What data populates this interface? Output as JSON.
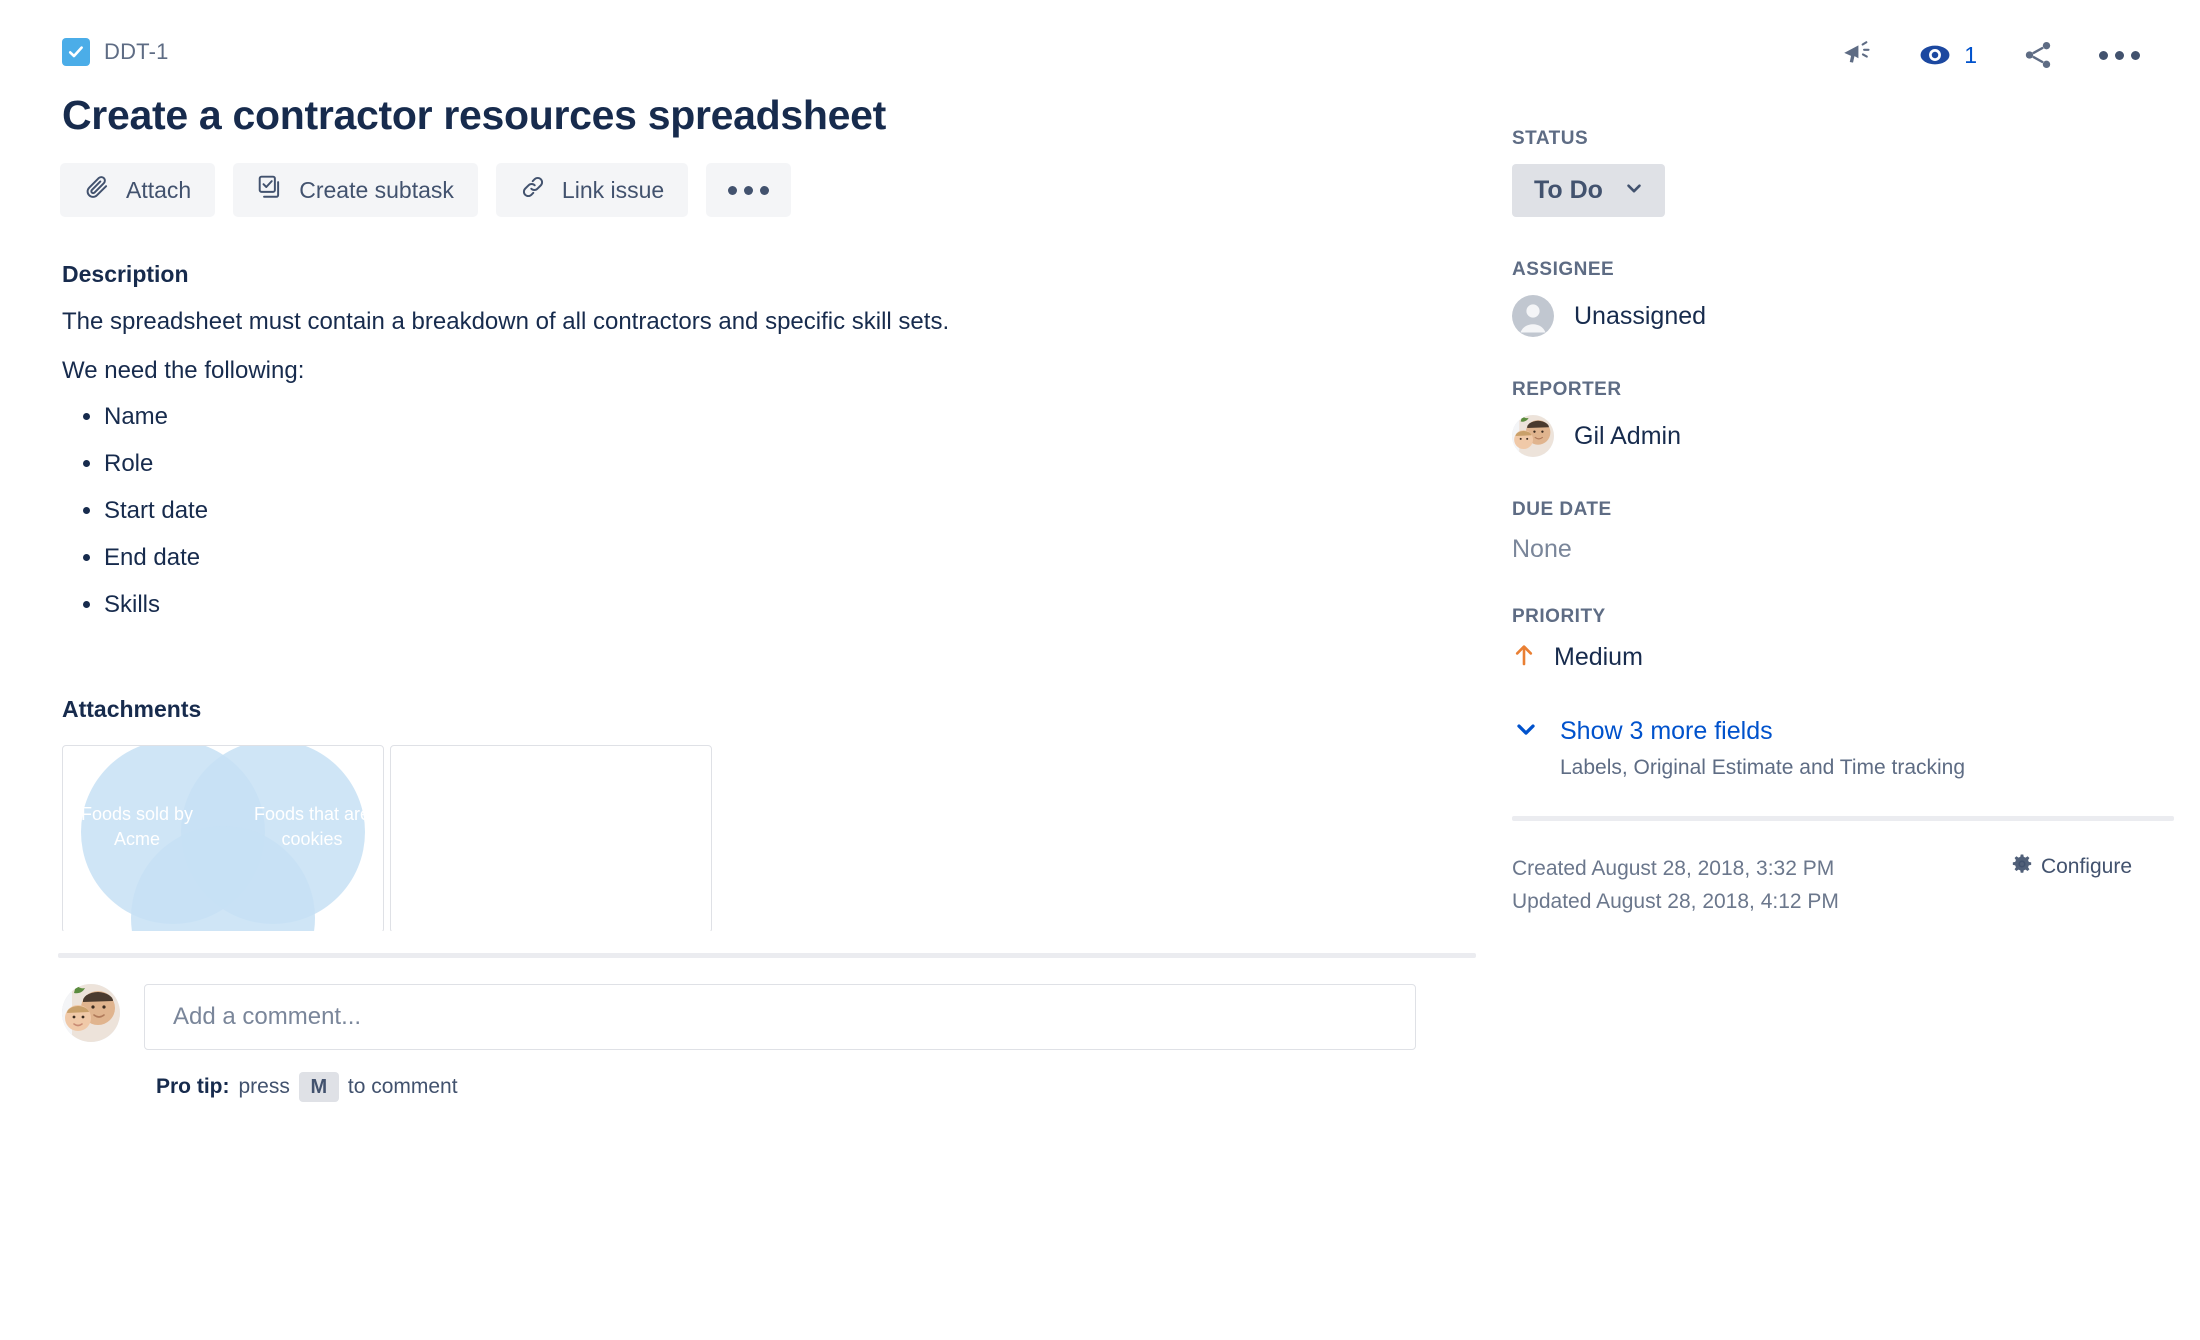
{
  "issue": {
    "key": "DDT-1",
    "type_icon": "task-checkbox-icon",
    "title": "Create a contractor resources spreadsheet"
  },
  "topbar": {
    "feedback_icon": "megaphone-icon",
    "watch_icon": "eye-watch-icon",
    "watch_count": "1",
    "share_icon": "share-icon",
    "more_icon": "more-ellipsis-icon"
  },
  "actions": [
    {
      "label": "Attach",
      "icon": "paperclip-icon"
    },
    {
      "label": "Create subtask",
      "icon": "subtask-checkbox-icon"
    },
    {
      "label": "Link issue",
      "icon": "link-chain-icon"
    }
  ],
  "actions_more_icon": "more-ellipsis-icon",
  "description": {
    "heading": "Description",
    "paragraph": "The spreadsheet must contain a breakdown of all contractors and specific skill sets.",
    "intro": "We need the following:",
    "items": [
      "Name",
      "Role",
      "Start date",
      "End date",
      "Skills"
    ]
  },
  "attachments": {
    "heading": "Attachments",
    "thumbnail": {
      "label_left": "Foods sold by Acme",
      "label_right": "Foods that are cookies",
      "circle_color": "#C7E1F5"
    }
  },
  "comment": {
    "placeholder": "Add a comment...",
    "protip_prefix": "Pro tip:",
    "protip_press": "press",
    "protip_key": "M",
    "protip_suffix": "to comment"
  },
  "sidebar": {
    "status": {
      "label": "Status",
      "value": "To Do",
      "chevron": "chevron-down-icon"
    },
    "assignee": {
      "label": "Assignee",
      "value": "Unassigned",
      "avatar": "default-user-avatar"
    },
    "reporter": {
      "label": "Reporter",
      "value": "Gil Admin",
      "avatar": "user-photo-avatar"
    },
    "due_date": {
      "label": "Due date",
      "value": "None"
    },
    "priority": {
      "label": "Priority",
      "value": "Medium",
      "icon": "priority-medium-arrow-icon",
      "color": "#E97F33"
    },
    "more_fields": {
      "link": "Show 3 more fields",
      "sub": "Labels, Original Estimate and Time tracking",
      "chevron": "chevron-down-icon"
    },
    "meta": {
      "created": "Created August 28, 2018, 3:32 PM",
      "updated": "Updated August 28, 2018, 4:12 PM",
      "configure": "Configure",
      "configure_icon": "gear-icon"
    }
  },
  "colors": {
    "brand_blue": "#0052CC",
    "text": "#172B4D",
    "muted": "#5E6C84",
    "chip_bg": "#DFE1E6"
  }
}
